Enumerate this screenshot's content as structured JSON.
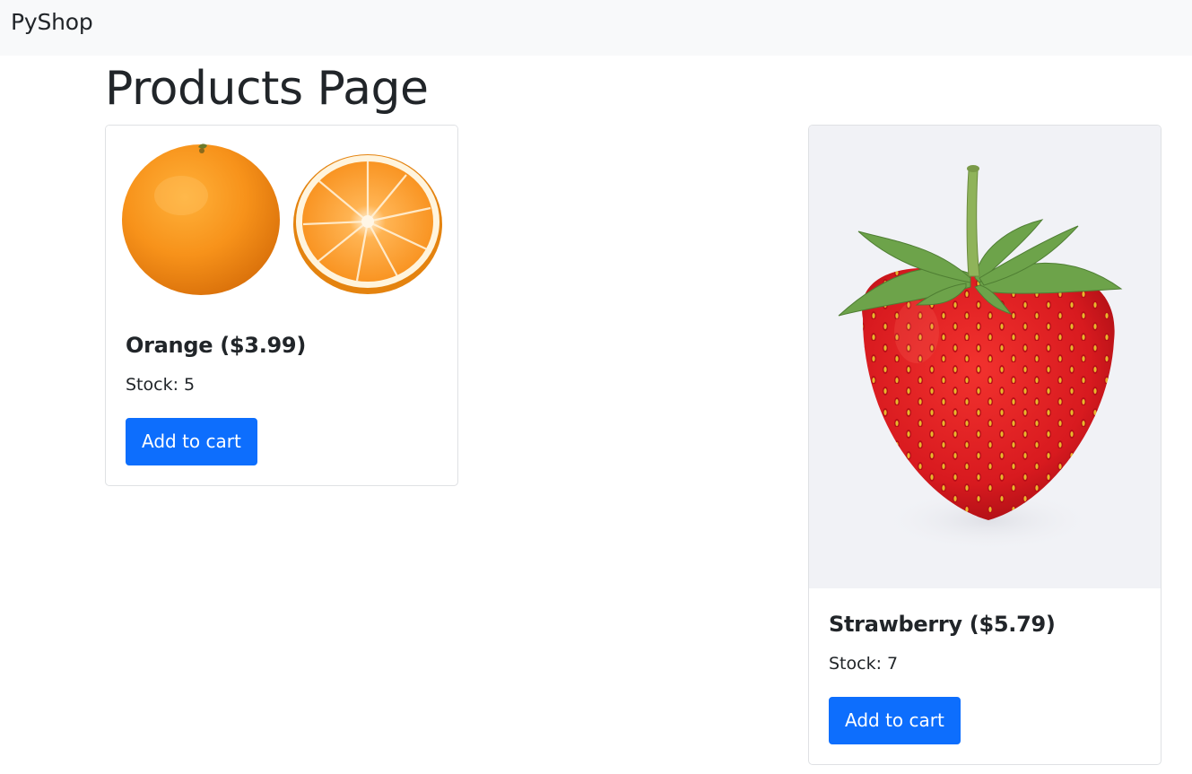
{
  "navbar": {
    "brand": "PyShop"
  },
  "page": {
    "title": "Products Page"
  },
  "products": [
    {
      "title": "Orange ($3.99)",
      "stock": "Stock: 5",
      "button_label": "Add to cart",
      "image_icon": "orange-fruit-image"
    },
    {
      "title": "Strawberry ($5.79)",
      "stock": "Stock: 7",
      "button_label": "Add to cart",
      "image_icon": "strawberry-fruit-image"
    }
  ],
  "colors": {
    "primary": "#0d6efd",
    "navbar_bg": "#f8f9fa",
    "text": "#212529"
  }
}
